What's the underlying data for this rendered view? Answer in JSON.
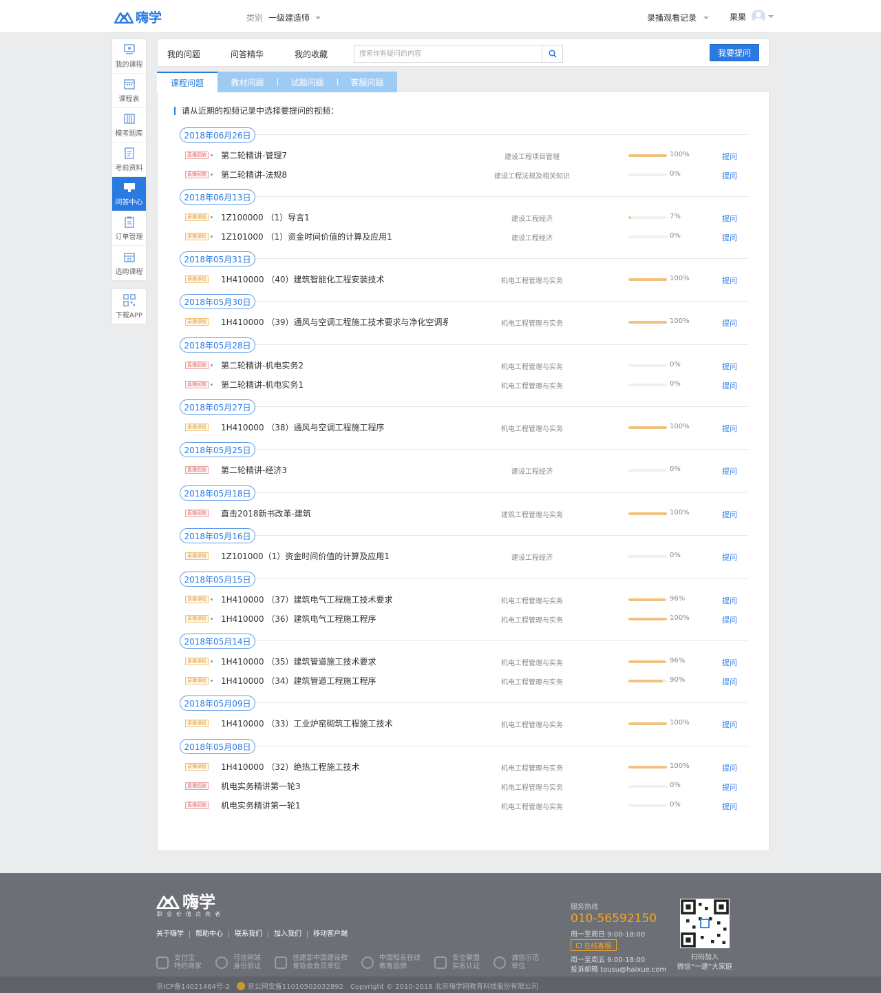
{
  "header": {
    "logo_text": "嗨学",
    "category_label": "类别",
    "category_value": "一级建造师",
    "records_label": "录播观看记录",
    "user_name": "果果"
  },
  "sidebar": {
    "items": [
      {
        "label": "我的课程",
        "icon": "my-course-icon"
      },
      {
        "label": "课程表",
        "icon": "schedule-icon"
      },
      {
        "label": "模考题库",
        "icon": "question-bank-icon"
      },
      {
        "label": "考前资料",
        "icon": "materials-icon"
      },
      {
        "label": "问答中心",
        "icon": "qa-center-icon",
        "active": true
      },
      {
        "label": "订单管理",
        "icon": "order-icon"
      },
      {
        "label": "选购课程",
        "icon": "shop-icon"
      }
    ],
    "download": {
      "label": "下载APP",
      "icon": "qr-code-icon"
    }
  },
  "qbar": {
    "tabs": [
      "我的问题",
      "问答精华",
      "我的收藏"
    ],
    "search_placeholder": "搜索你有疑问的内容",
    "ask_button": "我要提问"
  },
  "subtabs": [
    "课程问题",
    "教材问题",
    "试题问题",
    "客服问题"
  ],
  "instruction": "请从近期的视频记录中选择要提问的视频：",
  "badges": {
    "live": "直播回放",
    "recorded": "录播课程"
  },
  "ask_label": "提问",
  "days": [
    {
      "date": "2018年06月26日",
      "rows": [
        {
          "type": "live",
          "dot": true,
          "title": "第二轮精讲-管理7",
          "subject": "建设工程项目管理",
          "progress": 100
        },
        {
          "type": "live",
          "dot": true,
          "title": "第二轮精讲-法规8",
          "subject": "建设工程法规及相关知识",
          "progress": 0
        }
      ]
    },
    {
      "date": "2018年06月13日",
      "rows": [
        {
          "type": "rec",
          "dot": true,
          "title": "1Z100000 （1）导言1",
          "subject": "建设工程经济",
          "progress": 7
        },
        {
          "type": "rec",
          "dot": true,
          "title": "1Z101000 （1）资金时间价值的计算及应用1",
          "subject": "建设工程经济",
          "progress": 0
        }
      ]
    },
    {
      "date": "2018年05月31日",
      "rows": [
        {
          "type": "rec",
          "dot": false,
          "title": "1H410000 （40）建筑智能化工程安装技术",
          "subject": "机电工程管理与实务",
          "progress": 100
        }
      ]
    },
    {
      "date": "2018年05月30日",
      "rows": [
        {
          "type": "rec",
          "dot": false,
          "title": "1H410000 （39）通风与空调工程施工技术要求与净化空调系...",
          "subject": "机电工程管理与实务",
          "progress": 100
        }
      ]
    },
    {
      "date": "2018年05月28日",
      "rows": [
        {
          "type": "live",
          "dot": true,
          "title": "第二轮精讲-机电实务2",
          "subject": "机电工程管理与实务",
          "progress": 0
        },
        {
          "type": "live",
          "dot": true,
          "title": "第二轮精讲-机电实务1",
          "subject": "机电工程管理与实务",
          "progress": 0
        }
      ]
    },
    {
      "date": "2018年05月27日",
      "rows": [
        {
          "type": "rec",
          "dot": false,
          "title": "1H410000 （38）通风与空调工程施工程序",
          "subject": "机电工程管理与实务",
          "progress": 100
        }
      ]
    },
    {
      "date": "2018年05月25日",
      "rows": [
        {
          "type": "live",
          "dot": false,
          "title": "第二轮精讲-经济3",
          "subject": "建设工程经济",
          "progress": 0
        }
      ]
    },
    {
      "date": "2018年05月18日",
      "rows": [
        {
          "type": "live",
          "dot": false,
          "title": "直击2018新书改革-建筑",
          "subject": "建筑工程管理与实务",
          "progress": 100
        }
      ]
    },
    {
      "date": "2018年05月16日",
      "rows": [
        {
          "type": "rec",
          "dot": false,
          "title": "1Z101000（1）资金时间价值的计算及应用1",
          "subject": "建设工程经济",
          "progress": 0
        }
      ]
    },
    {
      "date": "2018年05月15日",
      "rows": [
        {
          "type": "rec",
          "dot": true,
          "title": "1H410000 （37）建筑电气工程施工技术要求",
          "subject": "机电工程管理与实务",
          "progress": 96
        },
        {
          "type": "rec",
          "dot": true,
          "title": "1H410000 （36）建筑电气工程施工程序",
          "subject": "机电工程管理与实务",
          "progress": 100
        }
      ]
    },
    {
      "date": "2018年05月14日",
      "rows": [
        {
          "type": "rec",
          "dot": true,
          "title": "1H410000 （35）建筑管道施工技术要求",
          "subject": "机电工程管理与实务",
          "progress": 96
        },
        {
          "type": "rec",
          "dot": true,
          "title": "1H410000 （34）建筑管道工程施工程序",
          "subject": "机电工程管理与实务",
          "progress": 90
        }
      ]
    },
    {
      "date": "2018年05月09日",
      "rows": [
        {
          "type": "rec",
          "dot": false,
          "title": "1H410000 （33）工业炉窑砌筑工程施工技术",
          "subject": "机电工程管理与实务",
          "progress": 100
        }
      ]
    },
    {
      "date": "2018年05月08日",
      "rows": [
        {
          "type": "rec",
          "dot": false,
          "title": "1H410000 （32）绝热工程施工技术",
          "subject": "机电工程管理与实务",
          "progress": 100
        },
        {
          "type": "live",
          "dot": false,
          "title": "机电实务精讲第一轮3",
          "subject": "机电工程管理与实务",
          "progress": 0
        },
        {
          "type": "live",
          "dot": false,
          "title": "机电实务精讲第一轮1",
          "subject": "机电工程管理与实务",
          "progress": 0
        }
      ]
    }
  ],
  "footer": {
    "logo_text": "嗨学",
    "slogan": "职业价值点亮者",
    "links": [
      "关于嗨学",
      "帮助中心",
      "联系我们",
      "加入我们",
      "移动客户端"
    ],
    "certs": [
      {
        "line1": "支付宝",
        "line2": "特约商家"
      },
      {
        "line1": "可信网站",
        "line2": "身份验证"
      },
      {
        "line1": "住建部中国建设教",
        "line2": "育协会会员单位"
      },
      {
        "line1": "中国知名在线",
        "line2": "教育品牌"
      },
      {
        "line1": "安全联盟",
        "line2": "实名认证"
      },
      {
        "line1": "诚信示范",
        "line2": "单位"
      }
    ],
    "hotline_label": "服务热线",
    "hotline_number": "010-56592150",
    "hotline_hours": "周一至周日 9:00-18:00",
    "online_service": "在线客服",
    "service_hours": "周一至周五 9:00-18:00",
    "complaint_email": "投诉邮箱 tousu@haixue.com",
    "qr_caption_1": "扫码加入",
    "qr_caption_2": "微信“一建”大家庭",
    "icp": "京ICP备14021464号-2",
    "police": "京公网安备11010502032892",
    "copyright": "Copyright © 2010-2018 北京嗨学网教育科技股份有限公司"
  }
}
